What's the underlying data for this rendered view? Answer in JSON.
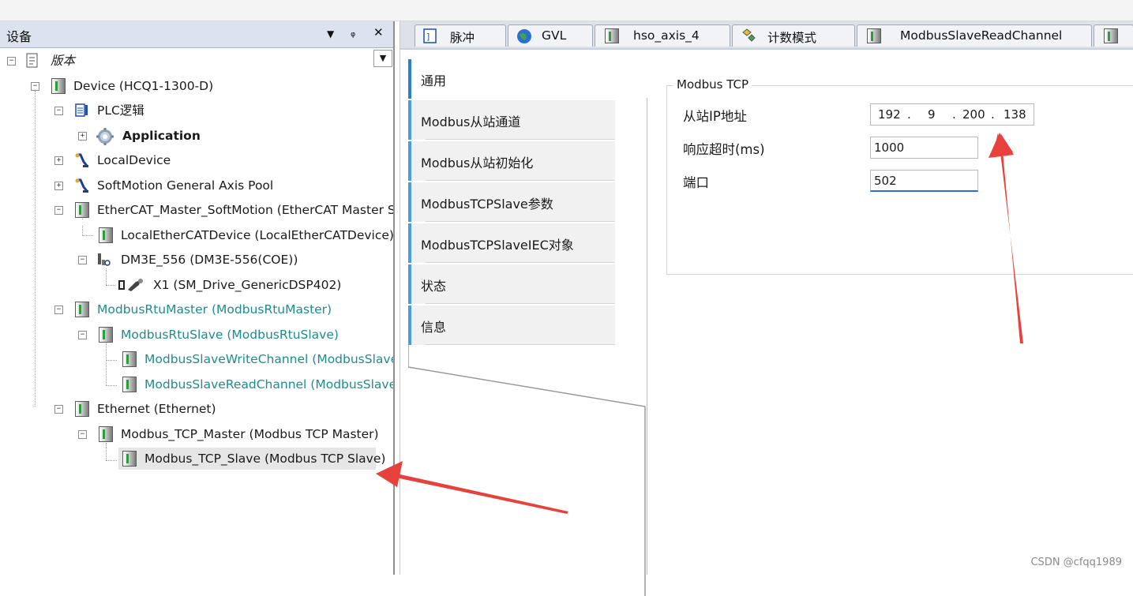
{
  "left_pane": {
    "title": "设备",
    "buttons": {
      "dropdown": "▼",
      "pin": "ᵩ",
      "close": "✕"
    },
    "tree": [
      {
        "label": "版本",
        "expander": "−"
      },
      {
        "label": "Device (HCQ1-1300-D)",
        "expander": "−"
      },
      {
        "label": "PLC逻辑",
        "expander": "−"
      },
      {
        "label": "Application",
        "expander": "+"
      },
      {
        "label": "LocalDevice",
        "expander": "+"
      },
      {
        "label": "SoftMotion General Axis Pool",
        "expander": "+"
      },
      {
        "label": "EtherCAT_Master_SoftMotion (EtherCAT Master SoftMotion)",
        "expander": "−"
      },
      {
        "label": "LocalEtherCATDevice (LocalEtherCATDevice)",
        "expander": ""
      },
      {
        "label": "DM3E_556 (DM3E-556(COE))",
        "expander": "−"
      },
      {
        "label": "X1 (SM_Drive_GenericDSP402)",
        "expander": ""
      },
      {
        "label": "ModbusRtuMaster (ModbusRtuMaster)",
        "expander": "−"
      },
      {
        "label": "ModbusRtuSlave (ModbusRtuSlave)",
        "expander": "−"
      },
      {
        "label": "ModbusSlaveWriteChannel (ModbusSlaveWriteChannel)",
        "expander": ""
      },
      {
        "label": "ModbusSlaveReadChannel (ModbusSlaveReadChannel)",
        "expander": ""
      },
      {
        "label": "Ethernet (Ethernet)",
        "expander": "−"
      },
      {
        "label": "Modbus_TCP_Master (Modbus TCP Master)",
        "expander": "−"
      },
      {
        "label": "Modbus_TCP_Slave (Modbus TCP Slave)",
        "expander": ""
      }
    ]
  },
  "editor": {
    "tabs": [
      {
        "label": "脉冲"
      },
      {
        "label": "GVL"
      },
      {
        "label": "hso_axis_4"
      },
      {
        "label": "计数模式"
      },
      {
        "label": "ModbusSlaveReadChannel"
      }
    ],
    "config_tabs": [
      "通用",
      "Modbus从站通道",
      "Modbus从站初始化",
      "ModbusTCPSlave参数",
      "ModbusTCPSlaveIEC对象",
      "状态",
      "信息"
    ],
    "group_title": "Modbus TCP",
    "fields": {
      "ip_label": "从站IP地址",
      "ip": [
        "192",
        "9",
        "200",
        "138"
      ],
      "ip_dot": ".",
      "timeout_label": "响应超时(ms)",
      "timeout_value": "1000",
      "port_label": "端口",
      "port_value": "502"
    }
  },
  "watermark": "CSDN @cfqq1989",
  "colors": {
    "accent": "#2a7fd4",
    "teal_text": "#1f8c8c",
    "arrow": "#e8413b"
  }
}
